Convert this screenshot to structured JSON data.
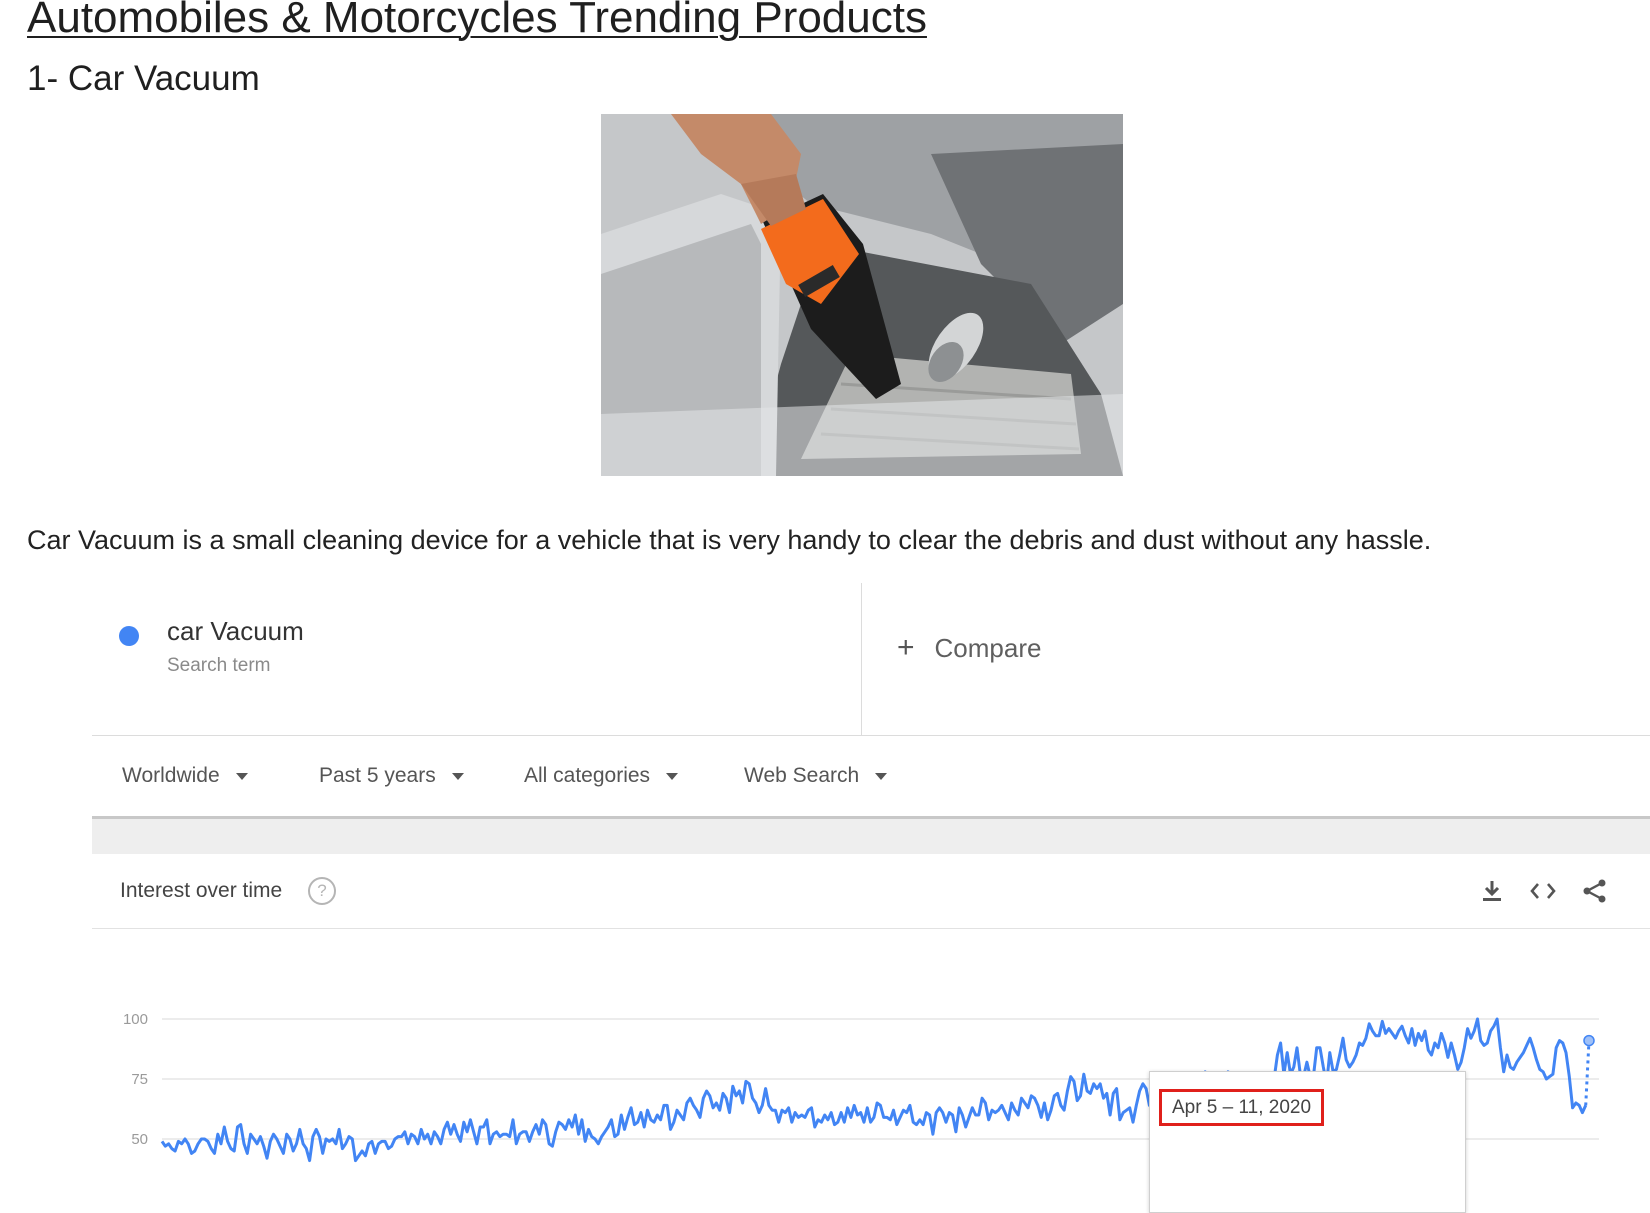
{
  "article": {
    "title": "Automobiles & Motorcycles Trending Products",
    "subtitle": "1- Car Vacuum",
    "description": "Car Vacuum is a small cleaning device for a vehicle that is very handy to clear the debris and dust without any hassle."
  },
  "trends": {
    "term": {
      "name": "car Vacuum",
      "type": "Search term",
      "color": "#4285f4"
    },
    "compare_label": "Compare",
    "filters": [
      {
        "label": "Worldwide"
      },
      {
        "label": "Past 5 years"
      },
      {
        "label": "All categories"
      },
      {
        "label": "Web Search"
      }
    ],
    "section_title": "Interest over time",
    "header_icons": [
      "download-icon",
      "embed-code-icon",
      "share-icon"
    ],
    "tooltip_date": "Apr 5 – 11, 2020",
    "tooltip_highlight_color": "#e0201b"
  },
  "chart_data": {
    "type": "line",
    "title": "",
    "xlabel": "",
    "ylabel": "",
    "ylim": [
      0,
      100
    ],
    "y_ticks": [
      "100",
      "75",
      "50"
    ],
    "grid": true,
    "series": [
      {
        "name": "car Vacuum",
        "color": "#4285f4",
        "values": [
          49,
          47,
          48,
          46,
          45,
          49,
          48,
          50,
          48,
          44,
          45,
          48,
          50,
          50,
          49,
          46,
          44,
          52,
          48,
          55,
          49,
          46,
          45,
          55,
          56,
          48,
          44,
          52,
          50,
          48,
          51,
          47,
          42,
          49,
          52,
          50,
          47,
          44,
          52,
          50,
          45,
          48,
          54,
          48,
          46,
          41,
          51,
          54,
          51,
          44,
          50,
          49,
          50,
          48,
          54,
          46,
          48,
          51,
          50,
          41,
          43,
          45,
          43,
          48,
          49,
          44,
          48,
          49,
          49,
          46,
          47,
          50,
          51,
          51,
          53,
          48,
          52,
          51,
          48,
          54,
          50,
          52,
          48,
          53,
          51,
          48,
          54,
          57,
          52,
          56,
          52,
          49,
          57,
          53,
          58,
          53,
          48,
          55,
          55,
          58,
          48,
          52,
          53,
          51,
          52,
          52,
          51,
          58,
          48,
          52,
          53,
          53,
          49,
          53,
          56,
          52,
          58,
          56,
          48,
          47,
          53,
          57,
          56,
          54,
          58,
          55,
          60,
          52,
          58,
          49,
          54,
          51,
          50,
          48,
          51,
          53,
          55,
          58,
          51,
          52,
          60,
          54,
          59,
          63,
          56,
          57,
          61,
          55,
          62,
          58,
          57,
          60,
          58,
          64,
          64,
          54,
          57,
          62,
          60,
          58,
          65,
          67,
          64,
          62,
          59,
          67,
          70,
          68,
          63,
          65,
          62,
          69,
          67,
          61,
          72,
          68,
          70,
          65,
          74,
          73,
          67,
          65,
          61,
          64,
          71,
          64,
          62,
          62,
          57,
          62,
          61,
          63,
          57,
          61,
          59,
          60,
          59,
          62,
          63,
          55,
          58,
          57,
          60,
          58,
          61,
          56,
          57,
          61,
          57,
          63,
          59,
          64,
          60,
          61,
          57,
          63,
          57,
          59,
          65,
          64,
          59,
          59,
          58,
          62,
          56,
          59,
          62,
          61,
          64,
          57,
          56,
          58,
          56,
          61,
          60,
          52,
          61,
          63,
          61,
          57,
          61,
          60,
          53,
          63,
          60,
          55,
          59,
          63,
          60,
          60,
          67,
          65,
          58,
          62,
          61,
          62,
          64,
          61,
          58,
          65,
          62,
          60,
          67,
          65,
          63,
          68,
          67,
          64,
          59,
          65,
          58,
          62,
          68,
          69,
          64,
          62,
          70,
          76,
          74,
          66,
          68,
          77,
          70,
          69,
          73,
          71,
          73,
          67,
          69,
          60,
          69,
          71,
          58,
          61,
          62,
          63,
          57,
          64,
          70,
          73,
          71,
          64,
          72,
          71,
          65,
          62,
          69,
          75,
          68,
          69,
          65,
          61,
          72,
          74,
          67,
          69,
          64,
          76,
          78,
          70,
          74,
          77,
          69,
          64,
          71,
          78,
          70,
          77,
          68,
          67,
          63,
          60,
          59,
          58,
          62,
          66,
          72,
          77,
          73,
          75,
          85,
          90,
          77,
          86,
          77,
          80,
          88,
          77,
          76,
          82,
          76,
          76,
          88,
          88,
          80,
          73,
          86,
          78,
          79,
          85,
          92,
          83,
          80,
          82,
          85,
          90,
          89,
          92,
          98,
          95,
          93,
          93,
          99,
          94,
          96,
          94,
          92,
          95,
          97,
          93,
          90,
          96,
          89,
          94,
          91,
          95,
          87,
          85,
          90,
          88,
          94,
          90,
          84,
          90,
          85,
          79,
          82,
          88,
          96,
          92,
          95,
          100,
          91,
          89,
          90,
          95,
          97,
          100,
          88,
          78,
          85,
          80,
          79,
          82,
          84,
          86,
          89,
          92,
          88,
          83,
          79,
          78,
          75,
          76,
          77,
          88,
          91,
          90,
          86,
          76,
          63,
          65,
          64,
          61,
          64,
          91
        ]
      }
    ]
  }
}
